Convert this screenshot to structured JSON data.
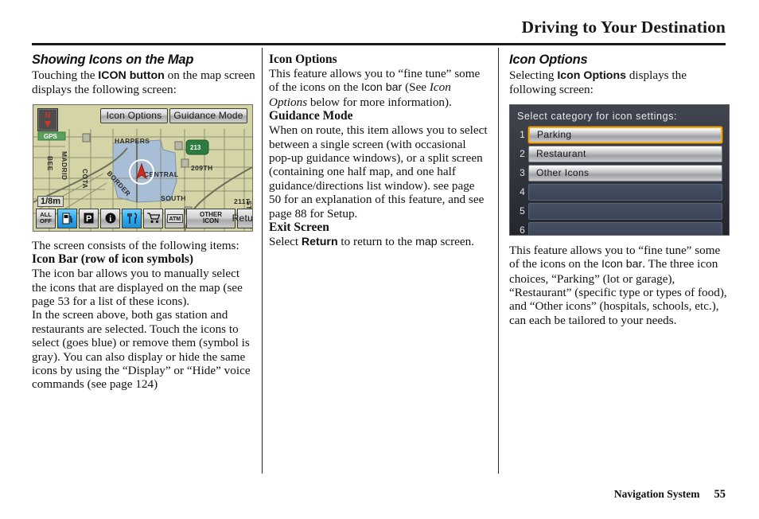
{
  "header": {
    "title": "Driving to Your Destination"
  },
  "footer": {
    "label": "Navigation System",
    "page_number": "55"
  },
  "columns": {
    "left": {
      "heading": "Showing Icons on the Map",
      "intro_a": "Touching the ",
      "intro_b": "ICON button",
      "intro_c": " on the map screen displays the following screen:",
      "after_figure": "The screen consists of the following items:",
      "subhead": "Icon Bar (row of icon symbols)",
      "para_1": "The icon bar allows you to manually select the icons that are displayed on the map (see page 53 for a list of these icons).",
      "para_2": "In the screen above, both gas station and restaurants are selected. Touch the icons to select (goes blue) or remove them (symbol is gray). You can also display or hide the same icons by using the “Display” or “Hide” voice commands (see page 124)"
    },
    "middle": {
      "subhead_1": "Icon Options",
      "p1_a": "This feature allows you to “fine tune” some of the icons on the ",
      "p1_ui": "Icon bar",
      "p1_b": " (See ",
      "p1_it": "Icon Options",
      "p1_c": " below for more information).",
      "subhead_2": "Guidance Mode",
      "p2": "When on route, this item allows you to select between a single screen (with occasional pop-up guidance windows), or a split screen (containing one half map, and one half guidance/directions list window). see page 50 for an explanation of this feature, and see page 88 for Setup.",
      "subhead_3": "Exit Screen",
      "p3_a": "Select ",
      "p3_b": "Return",
      "p3_c": " to return to the ",
      "p3_ui": "map",
      "p3_d": " screen."
    },
    "right": {
      "heading": "Icon Options",
      "intro_a": "Selecting ",
      "intro_b": "Icon Options",
      "intro_c": " displays the following screen:",
      "body_a": "This feature allows you to “fine tune” some of the icons on the ",
      "body_ui": "Icon bar",
      "body_b": ". The three icon choices, “Parking” (lot or garage), “Restaurant” (specific type or types of food), and “Other icons” (hospitals, schools, etc.), can each be tailored to your needs."
    }
  },
  "map_figure": {
    "compass_label": "N",
    "scale_label": "1/8m",
    "top_buttons": [
      {
        "id": "icon-options",
        "label": "Icon Options"
      },
      {
        "id": "guidance-mode",
        "label": "Guidance Mode"
      }
    ],
    "map_labels": [
      "HARPERS",
      "CENTRAL",
      "SOUTH",
      "209TH",
      "211T",
      "MADRID",
      "BEE",
      "COTA",
      "BORDER",
      "GPS"
    ],
    "highway_shield": "213",
    "icon_bar": [
      {
        "id": "all-off",
        "label": "ALL\nOFF",
        "selected": false,
        "icon": "text"
      },
      {
        "id": "gas-station",
        "label": "",
        "selected": true,
        "icon": "gas-pump-icon"
      },
      {
        "id": "parking",
        "label": "P",
        "selected": false,
        "icon": "parking-icon"
      },
      {
        "id": "information",
        "label": "i",
        "selected": false,
        "icon": "info-icon"
      },
      {
        "id": "restaurant",
        "label": "",
        "selected": true,
        "icon": "restaurant-icon"
      },
      {
        "id": "shopping",
        "label": "",
        "selected": false,
        "icon": "shopping-cart-icon"
      },
      {
        "id": "atm",
        "label": "ATM",
        "selected": false,
        "icon": "atm-icon"
      },
      {
        "id": "other-icon",
        "label": "OTHER\nICON",
        "selected": false,
        "icon": "text"
      },
      {
        "id": "return",
        "label": "Return",
        "selected": false,
        "icon": "text"
      }
    ]
  },
  "list_figure": {
    "title": "Select category for icon settings:",
    "rows": [
      {
        "num": "1",
        "label": "Parking",
        "highlighted": true,
        "empty": false
      },
      {
        "num": "2",
        "label": "Restaurant",
        "highlighted": false,
        "empty": false
      },
      {
        "num": "3",
        "label": "Other Icons",
        "highlighted": false,
        "empty": false
      },
      {
        "num": "4",
        "label": "",
        "highlighted": false,
        "empty": true
      },
      {
        "num": "5",
        "label": "",
        "highlighted": false,
        "empty": true
      },
      {
        "num": "6",
        "label": "",
        "highlighted": false,
        "empty": true
      }
    ]
  },
  "colors": {
    "highlight_border": "#f0a81e",
    "selected_icon_blue": "#2ea8ee",
    "map_background": "#d5d4a6",
    "map_zone_blue": "#a8bdd6",
    "list_background": "#2b2f38"
  }
}
